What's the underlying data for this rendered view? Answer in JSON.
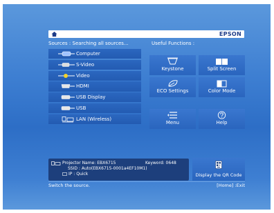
{
  "header": {
    "brand": "EPSON"
  },
  "sources": {
    "title": "Sources : Searching all sources...",
    "items": [
      {
        "label": "Computer",
        "icon": "computer-port-icon"
      },
      {
        "label": "S-Video",
        "icon": "svideo-port-icon"
      },
      {
        "label": "Video",
        "icon": "video-port-icon"
      },
      {
        "label": "HDMI",
        "icon": "hdmi-port-icon"
      },
      {
        "label": "USB Display",
        "icon": "usb-display-port-icon"
      },
      {
        "label": "USB",
        "icon": "usb-port-icon"
      },
      {
        "label": "LAN (Wireless)",
        "icon": "lan-wireless-icon"
      }
    ]
  },
  "functions": {
    "title": "Useful Functions :",
    "items": [
      {
        "label": "Keystone",
        "icon": "keystone-icon"
      },
      {
        "label": "Split Screen",
        "icon": "split-screen-icon",
        "icon_text": "1 2"
      },
      {
        "label": "ECO Settings",
        "icon": "eco-leaf-icon"
      },
      {
        "label": "Color Mode",
        "icon": "color-mode-icon"
      },
      {
        "label": "Menu",
        "icon": "menu-icon"
      },
      {
        "label": "Help",
        "icon": "help-icon",
        "icon_text": "?"
      }
    ]
  },
  "info": {
    "projector_name_line": "Projector Name:  EBX6715",
    "keyword_line": "Keyword:  0648",
    "ssid_line": "SSID  : Auto(EBX6715-0001a4EF10M1)",
    "ip_line": "IP  : Quick"
  },
  "qr": {
    "label": "Display the QR Code"
  },
  "status": {
    "hint": "Switch the source.",
    "exit": "[Home] :Exit"
  }
}
